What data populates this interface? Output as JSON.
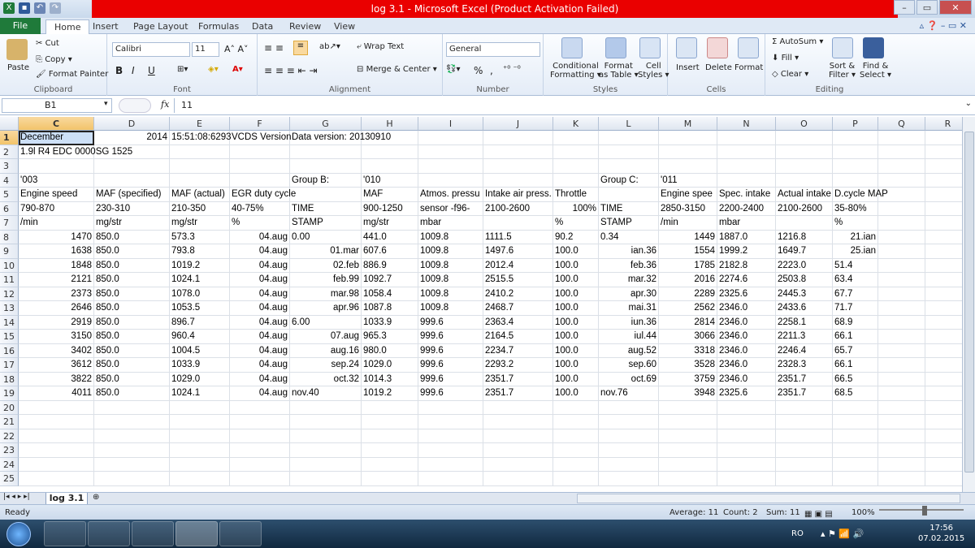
{
  "window": {
    "title": "log 3.1  -  Microsoft Excel (Product Activation Failed)"
  },
  "ribbon_tabs": [
    "File",
    "Home",
    "Insert",
    "Page Layout",
    "Formulas",
    "Data",
    "Review",
    "View"
  ],
  "clipboard": {
    "paste": "Paste",
    "cut": "Cut",
    "copy": "Copy",
    "format_painter": "Format Painter",
    "label": "Clipboard"
  },
  "font": {
    "name": "Calibri",
    "size": "11",
    "label": "Font"
  },
  "alignment": {
    "wrap": "Wrap Text",
    "merge": "Merge & Center",
    "label": "Alignment"
  },
  "number": {
    "format": "General",
    "percent": "%",
    "comma": ",",
    "label": "Number"
  },
  "styles": {
    "conditional": "Conditional",
    "formatting": "Formatting",
    "format_as": "Format",
    "as_table": "as Table",
    "cell": "Cell",
    "cell_styles": "Styles",
    "label": "Styles"
  },
  "cells": {
    "insert": "Insert",
    "delete": "Delete",
    "format": "Format",
    "label": "Cells"
  },
  "editing": {
    "autosum": "AutoSum",
    "fill": "Fill",
    "clear": "Clear",
    "sort": "Sort &",
    "filter": "Filter",
    "find": "Find &",
    "select": "Select",
    "label": "Editing"
  },
  "formula_bar": {
    "name_box": "B1",
    "fx": "fx",
    "value": "11"
  },
  "columns": [
    "C",
    "D",
    "E",
    "F",
    "G",
    "H",
    "I",
    "J",
    "K",
    "L",
    "M",
    "N",
    "O",
    "P",
    "Q",
    "R"
  ],
  "rows": [
    {
      "n": "1",
      "cells": [
        "December",
        "2014",
        "15:51:08:6293",
        "VCDS Version",
        "Data version: 20130910",
        "",
        "",
        "",
        "",
        "",
        "",
        "",
        "",
        "",
        "",
        ""
      ]
    },
    {
      "n": "2",
      "cells": [
        "1.9l R4 EDC 0000SG  1525",
        "",
        "",
        "",
        "",
        "",
        "",
        "",
        "",
        "",
        "",
        "",
        "",
        "",
        "",
        ""
      ]
    },
    {
      "n": "3",
      "cells": [
        "",
        "",
        "",
        "",
        "",
        "",
        "",
        "",
        "",
        "",
        "",
        "",
        "",
        "",
        "",
        ""
      ]
    },
    {
      "n": "4",
      "cells": [
        "'003",
        "",
        "",
        "",
        "Group B:",
        "'010",
        "",
        "",
        "",
        "Group C:",
        "'011",
        "",
        "",
        "",
        "",
        ""
      ]
    },
    {
      "n": "5",
      "cells": [
        "Engine speed",
        "MAF (specified)",
        "MAF (actual)",
        "EGR duty cycle",
        "",
        "MAF",
        "Atmos. pressu",
        "Intake air press.",
        "Throttle",
        "",
        "Engine spee",
        "Spec. intake",
        "Actual intake",
        "D.cycle MAP",
        "",
        ""
      ]
    },
    {
      "n": "6",
      "cells": [
        "790-870",
        "230-310",
        "210-350",
        "40-75%",
        "TIME",
        "900-1250",
        "sensor -f96-",
        "2100-2600",
        "100%",
        "TIME",
        "2850-3150",
        "2200-2400",
        "2100-2600",
        "35-80%",
        "",
        ""
      ]
    },
    {
      "n": "7",
      "cells": [
        " /min",
        " mg/str",
        " mg/str",
        " %",
        "STAMP",
        " mg/str",
        " mbar",
        "",
        " %",
        "STAMP",
        " /min",
        " mbar",
        "",
        " %",
        "",
        ""
      ]
    },
    {
      "n": "8",
      "cells": [
        "1470",
        "850.0",
        "573.3",
        "04.aug",
        "0.00",
        "441.0",
        "1009.8",
        "1111.5",
        "90.2",
        "0.34",
        "1449",
        "1887.0",
        "1216.8",
        "21.ian",
        "",
        ""
      ]
    },
    {
      "n": "9",
      "cells": [
        "1638",
        "850.0",
        "793.8",
        "04.aug",
        "01.mar",
        "607.6",
        "1009.8",
        "1497.6",
        "100.0",
        "ian.36",
        "1554",
        "1999.2",
        "1649.7",
        "25.ian",
        "",
        ""
      ]
    },
    {
      "n": "10",
      "cells": [
        "1848",
        "850.0",
        "1019.2",
        "04.aug",
        "02.feb",
        "886.9",
        "1009.8",
        "2012.4",
        "100.0",
        "feb.36",
        "1785",
        "2182.8",
        "2223.0",
        "51.4",
        "",
        ""
      ]
    },
    {
      "n": "11",
      "cells": [
        "2121",
        "850.0",
        "1024.1",
        "04.aug",
        "feb.99",
        "1092.7",
        "1009.8",
        "2515.5",
        "100.0",
        "mar.32",
        "2016",
        "2274.6",
        "2503.8",
        "63.4",
        "",
        ""
      ]
    },
    {
      "n": "12",
      "cells": [
        "2373",
        "850.0",
        "1078.0",
        "04.aug",
        "mar.98",
        "1058.4",
        "1009.8",
        "2410.2",
        "100.0",
        "apr.30",
        "2289",
        "2325.6",
        "2445.3",
        "67.7",
        "",
        ""
      ]
    },
    {
      "n": "13",
      "cells": [
        "2646",
        "850.0",
        "1053.5",
        "04.aug",
        "apr.96",
        "1087.8",
        "1009.8",
        "2468.7",
        "100.0",
        "mai.31",
        "2562",
        "2346.0",
        "2433.6",
        "71.7",
        "",
        ""
      ]
    },
    {
      "n": "14",
      "cells": [
        "2919",
        "850.0",
        "896.7",
        "04.aug",
        "6.00",
        "1033.9",
        "999.6",
        "2363.4",
        "100.0",
        "iun.36",
        "2814",
        "2346.0",
        "2258.1",
        "68.9",
        "",
        ""
      ]
    },
    {
      "n": "15",
      "cells": [
        "3150",
        "850.0",
        "960.4",
        "04.aug",
        "07.aug",
        "965.3",
        "999.6",
        "2164.5",
        "100.0",
        "iul.44",
        "3066",
        "2346.0",
        "2211.3",
        "66.1",
        "",
        ""
      ]
    },
    {
      "n": "16",
      "cells": [
        "3402",
        "850.0",
        "1004.5",
        "04.aug",
        "aug.16",
        "980.0",
        "999.6",
        "2234.7",
        "100.0",
        "aug.52",
        "3318",
        "2346.0",
        "2246.4",
        "65.7",
        "",
        ""
      ]
    },
    {
      "n": "17",
      "cells": [
        "3612",
        "850.0",
        "1033.9",
        "04.aug",
        "sep.24",
        "1029.0",
        "999.6",
        "2293.2",
        "100.0",
        "sep.60",
        "3528",
        "2346.0",
        "2328.3",
        "66.1",
        "",
        ""
      ]
    },
    {
      "n": "18",
      "cells": [
        "3822",
        "850.0",
        "1029.0",
        "04.aug",
        "oct.32",
        "1014.3",
        "999.6",
        "2351.7",
        "100.0",
        "oct.69",
        "3759",
        "2346.0",
        "2351.7",
        "66.5",
        "",
        ""
      ]
    },
    {
      "n": "19",
      "cells": [
        "4011",
        "850.0",
        "1024.1",
        "04.aug",
        "nov.40",
        "1019.2",
        "999.6",
        "2351.7",
        "100.0",
        "nov.76",
        "3948",
        "2325.6",
        "2351.7",
        "68.5",
        "",
        ""
      ]
    },
    {
      "n": "20",
      "cells": [
        "",
        "",
        "",
        "",
        "",
        "",
        "",
        "",
        "",
        "",
        "",
        "",
        "",
        "",
        "",
        ""
      ]
    },
    {
      "n": "21",
      "cells": [
        "",
        "",
        "",
        "",
        "",
        "",
        "",
        "",
        "",
        "",
        "",
        "",
        "",
        "",
        "",
        ""
      ]
    },
    {
      "n": "22",
      "cells": [
        "",
        "",
        "",
        "",
        "",
        "",
        "",
        "",
        "",
        "",
        "",
        "",
        "",
        "",
        "",
        ""
      ]
    },
    {
      "n": "23",
      "cells": [
        "",
        "",
        "",
        "",
        "",
        "",
        "",
        "",
        "",
        "",
        "",
        "",
        "",
        "",
        "",
        ""
      ]
    },
    {
      "n": "24",
      "cells": [
        "",
        "",
        "",
        "",
        "",
        "",
        "",
        "",
        "",
        "",
        "",
        "",
        "",
        "",
        "",
        ""
      ]
    },
    {
      "n": "25",
      "cells": [
        "",
        "",
        "",
        "",
        "",
        "",
        "",
        "",
        "",
        "",
        "",
        "",
        "",
        "",
        "",
        ""
      ]
    }
  ],
  "sheet": {
    "tab": "log 3.1"
  },
  "status": {
    "ready": "Ready",
    "average": "Average: 11",
    "count": "Count: 2",
    "sum": "Sum: 11",
    "zoom": "100%"
  },
  "taskbar": {
    "lang": "RO",
    "time": "17:56",
    "date": "07.02.2015"
  }
}
